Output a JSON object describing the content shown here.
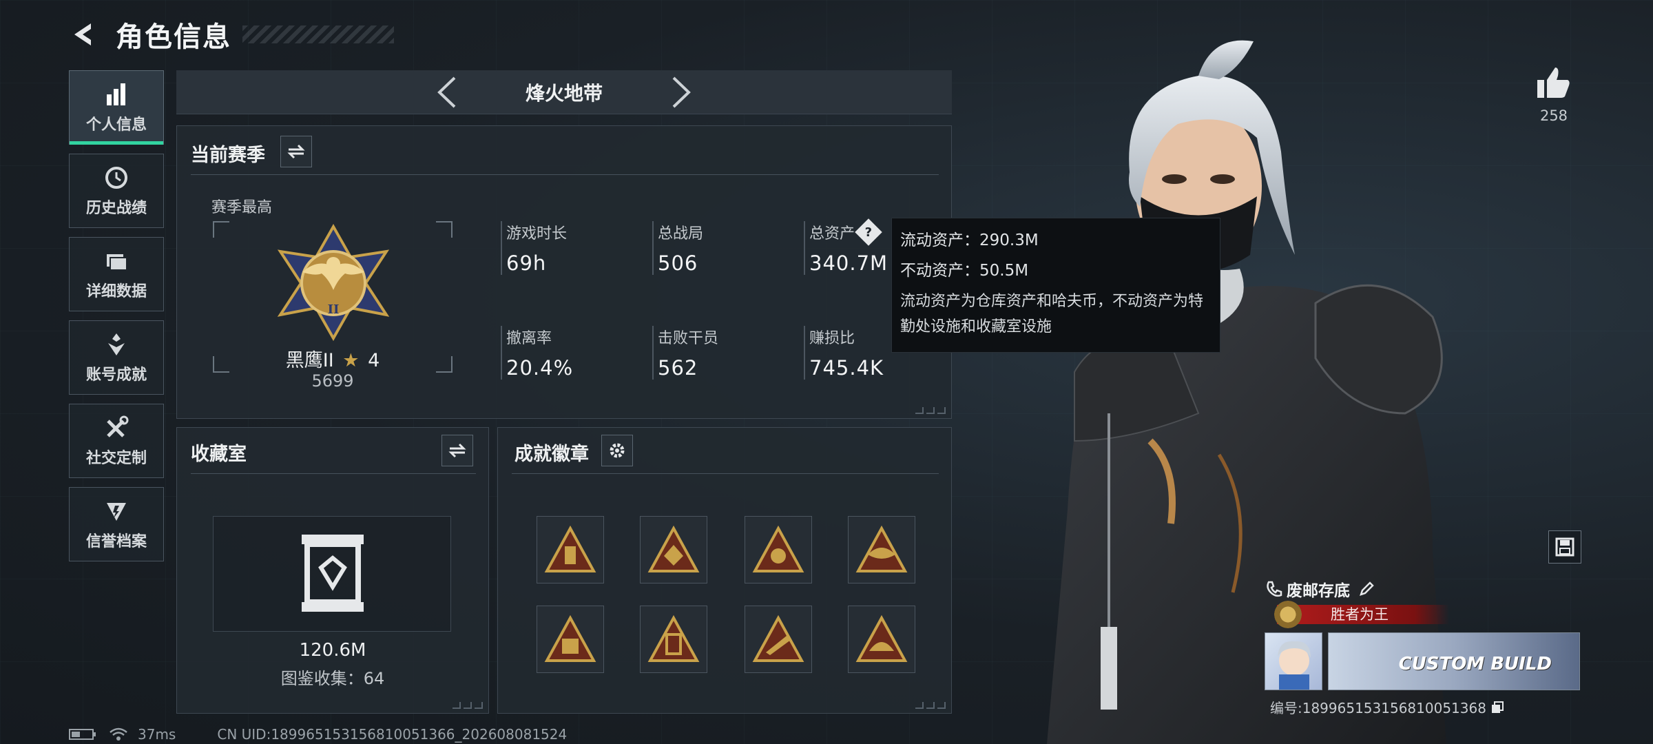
{
  "header": {
    "title": "角色信息"
  },
  "nav": [
    {
      "label": "个人信息",
      "icon": "bar-chart-icon",
      "active": true
    },
    {
      "label": "历史战绩",
      "icon": "clock-icon",
      "active": false
    },
    {
      "label": "详细数据",
      "icon": "folder-icon",
      "active": false
    },
    {
      "label": "账号成就",
      "icon": "trophy-icon",
      "active": false
    },
    {
      "label": "社交定制",
      "icon": "tools-icon",
      "active": false
    },
    {
      "label": "信誉档案",
      "icon": "shield-icon",
      "active": false
    }
  ],
  "mode": {
    "title": "烽火地带"
  },
  "season": {
    "title": "当前赛季",
    "best_label": "赛季最高",
    "rank_name": "黑鹰II",
    "rank_stars": "4",
    "rank_score": "5699",
    "stats": [
      {
        "label": "游戏时长",
        "value": "69h"
      },
      {
        "label": "总战局",
        "value": "506"
      },
      {
        "label": "总资产",
        "value": "340.7M"
      },
      {
        "label": "撤离率",
        "value": "20.4%"
      },
      {
        "label": "击败干员",
        "value": "562"
      },
      {
        "label": "赚损比",
        "value": "745.4K"
      }
    ]
  },
  "tooltip": {
    "liquid": "流动资产：290.3M",
    "fixed": "不动资产：50.5M",
    "desc": "流动资产为仓库资产和哈夫币，不动资产为特勤处设施和收藏室设施"
  },
  "collection": {
    "title": "收藏室",
    "value": "120.6M",
    "count": "图鉴收集：64"
  },
  "achievements": {
    "title": "成就徽章"
  },
  "likes": {
    "count": "258"
  },
  "player": {
    "name": "废邮存底",
    "title": "胜者为王",
    "banner_text": "CUSTOM BUILD",
    "id": "编号:18996515315681005136​8"
  },
  "status": {
    "ping": "37ms",
    "uid": "CN UID:18996515315681005136​6_202608081524"
  },
  "colors": {
    "accent": "#32d3a0",
    "gold": "#c9a24a",
    "title_red": "#b11c1c"
  }
}
